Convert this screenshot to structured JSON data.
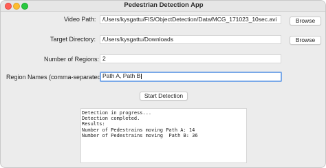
{
  "window": {
    "title": "Pedestrian Detection App"
  },
  "form": {
    "video_path": {
      "label": "Video Path:",
      "value": "/Users/kysgattu/FIS/ObjectDetection/Data/MCG_171023_10sec.avi",
      "button": "Browse"
    },
    "target_directory": {
      "label": "Target Directory:",
      "value": "/Users/kysgattu/Downloads",
      "button": "Browse"
    },
    "number_of_regions": {
      "label": "Number of Regions:",
      "value": "2"
    },
    "region_names": {
      "label": "Region Names (comma-separated):",
      "value": "Path A, Path B"
    }
  },
  "actions": {
    "start_detection": "Start Detection"
  },
  "output": {
    "lines": [
      "Detection in progress...",
      "Detection completed.",
      "Results:",
      "Number of Pedestrains moving Path A: 14",
      "Number of Pedestrains moving  Path B: 36"
    ]
  }
}
